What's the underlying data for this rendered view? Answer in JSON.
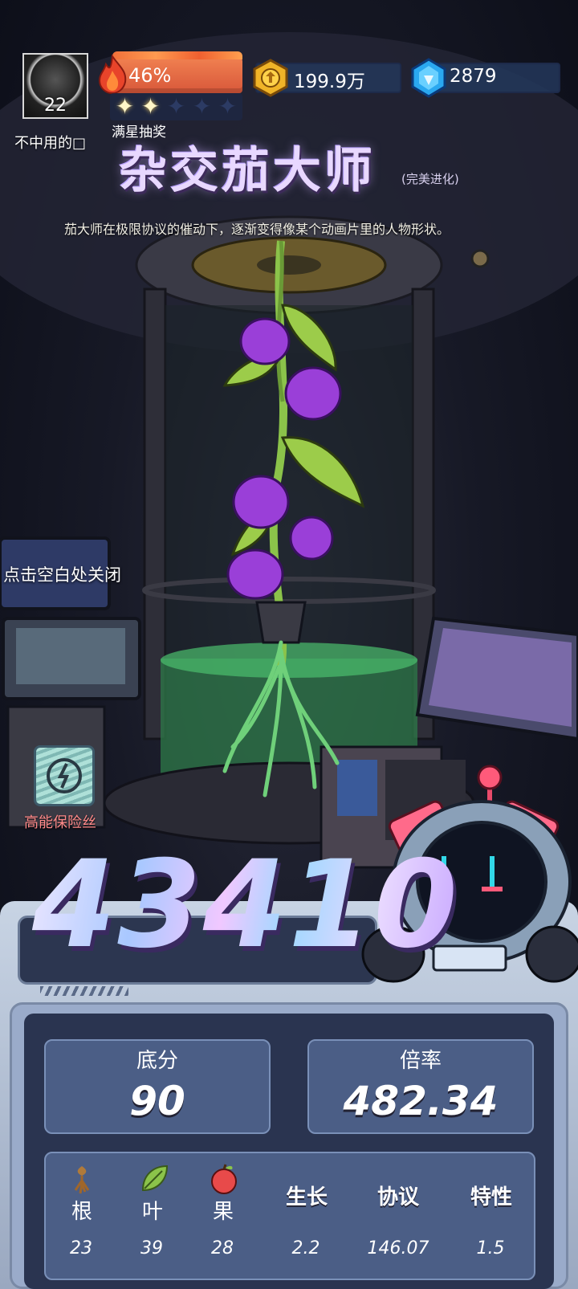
{
  "player": {
    "name": "不中用的□",
    "level": "22"
  },
  "hud": {
    "energy_percent": "46%",
    "energy_fraction": 0.46,
    "stars_total": 5,
    "stars_filled": 2,
    "lottery_label": "满星抽奖",
    "coins": "199.9万",
    "gems": "2879"
  },
  "plant": {
    "name": "杂交茄大师",
    "subtitle": "(完美进化)",
    "description": "茄大师在极限协议的催动下，逐渐变得像某个动画片里的人物形状。"
  },
  "close_hint": "点击空白处关闭",
  "fuse": {
    "label": "高能保险丝",
    "icon": "fuse-icon"
  },
  "score": {
    "total": "43410"
  },
  "stats": {
    "base_label": "底分",
    "base_value": "90",
    "mult_label": "倍率",
    "mult_value": "482.34"
  },
  "details": {
    "root_label": "根",
    "root_value": "23",
    "leaf_label": "叶",
    "leaf_value": "39",
    "fruit_label": "果",
    "fruit_value": "28",
    "growth_label": "生长",
    "growth_value": "2.2",
    "protocol_label": "协议",
    "protocol_value": "146.07",
    "trait_label": "特性",
    "trait_value": "1.5"
  },
  "colors": {
    "energy": "#d8573a",
    "panel": "#2a3450",
    "card": "#4b5e86",
    "fruit": "#9a3fd8",
    "leaf": "#8bc34a",
    "fuse_label": "#ff8a8a"
  }
}
